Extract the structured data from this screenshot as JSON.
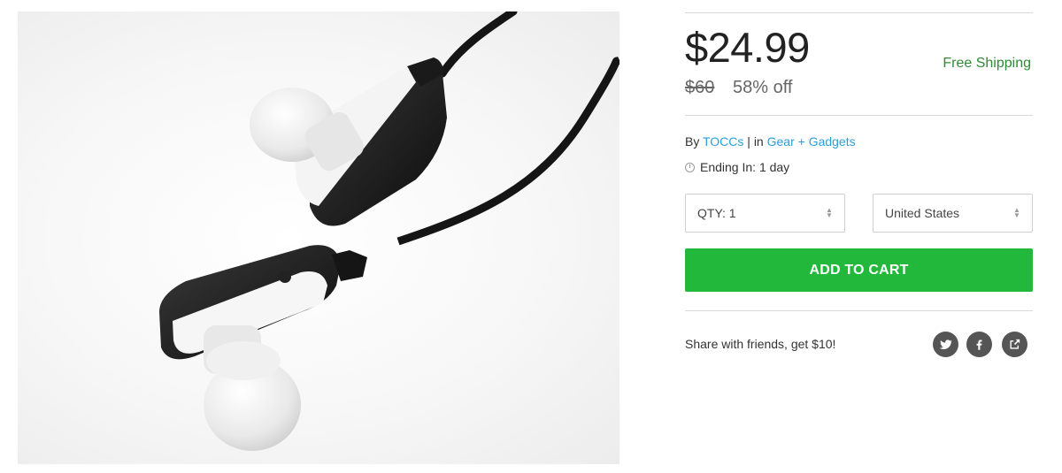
{
  "product": {
    "image_alt": "Bluetooth earbuds",
    "price": "$24.99",
    "original_price": "$60",
    "discount": "58% off",
    "shipping": "Free Shipping",
    "by_prefix": "By ",
    "vendor": "TOCCs",
    "separator": " | in ",
    "category": "Gear + Gadgets",
    "ending_label": "Ending In: 1 day"
  },
  "purchase": {
    "qty_label": "QTY: 1",
    "country": "United States",
    "add_to_cart": "ADD TO CART"
  },
  "share": {
    "text": "Share with friends, get $10!",
    "icons": [
      "twitter-icon",
      "facebook-icon",
      "share-icon"
    ]
  },
  "colors": {
    "accent_green": "#22b83c",
    "shipping_green": "#2e8b37",
    "link_blue": "#2a9fd6",
    "social_gray": "#555555"
  }
}
